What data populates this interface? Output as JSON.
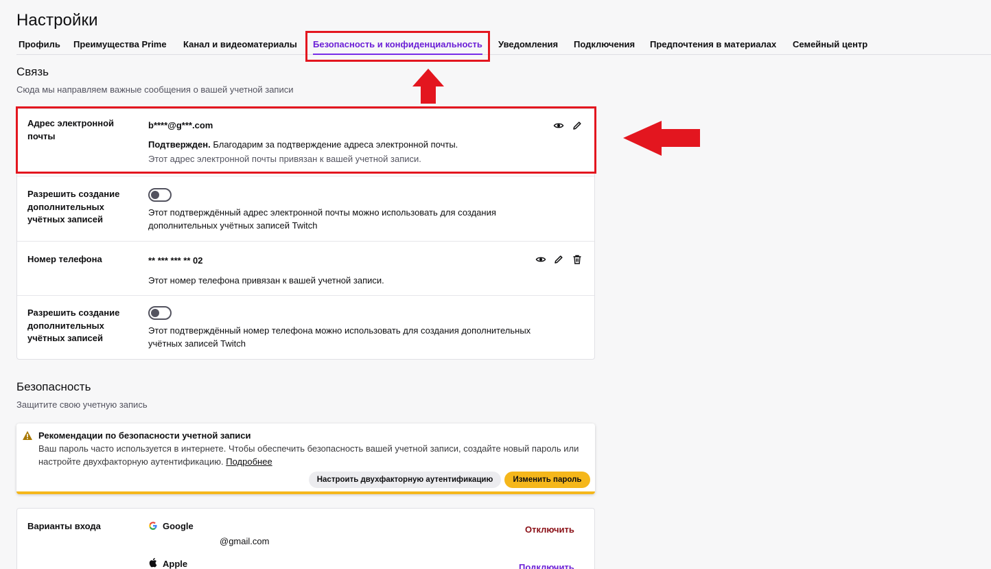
{
  "page": {
    "title": "Настройки"
  },
  "tabs": [
    {
      "label": "Профиль"
    },
    {
      "label": "Преимущества Prime"
    },
    {
      "label": "Канал и видеоматериалы"
    },
    {
      "label": "Безопасность и конфиденциальность",
      "active": true
    },
    {
      "label": "Уведомления"
    },
    {
      "label": "Подключения"
    },
    {
      "label": "Предпочтения в материалах"
    },
    {
      "label": "Семейный центр"
    }
  ],
  "contact": {
    "title": "Связь",
    "subtitle": "Сюда мы направляем важные сообщения о вашей учетной записи",
    "email": {
      "label": "Адрес электронной почты",
      "value": "b****@g***.com",
      "verified_bold": "Подтвержден.",
      "verified_text": "Благодарим за подтверждение адреса электронной почты.",
      "linked_text": "Этот адрес электронной почты привязан к вашей учетной записи."
    },
    "email_accounts": {
      "label": "Разрешить создание дополнительных учётных записей",
      "enabled": false,
      "text": "Этот подтверждённый адрес электронной почты можно использовать для создания дополнительных учётных записей Twitch"
    },
    "phone": {
      "label": "Номер телефона",
      "value": "** *** *** ** 02",
      "linked_text": "Этот номер телефона привязан к вашей учетной записи."
    },
    "phone_accounts": {
      "label": "Разрешить создание дополнительных учётных записей",
      "enabled": false,
      "text": "Этот подтверждённый номер телефона можно использовать для создания дополнительных учётных записей Twitch"
    }
  },
  "security": {
    "title": "Безопасность",
    "subtitle": "Защитите свою учетную запись",
    "alert": {
      "title": "Рекомендации по безопасности учетной записи",
      "text": "Ваш пароль часто используется в интернете. Чтобы обеспечить безопасность вашей учетной записи, создайте новый пароль или настройте двухфакторную аутентификацию.",
      "link": "Подробнее",
      "btn_2fa": "Настроить двухфакторную аутентификацию",
      "btn_password": "Изменить пароль"
    },
    "login": {
      "label": "Варианты входа",
      "google": {
        "name": "Google",
        "email": "@gmail.com",
        "action": "Отключить"
      },
      "apple": {
        "name": "Apple",
        "action": "Подключить"
      }
    }
  },
  "colors": {
    "accent": "#772ce8",
    "highlight_red": "#e3161f",
    "warning": "#f5b71b",
    "disconnect": "#8a0f16"
  },
  "icons": [
    "eye-icon",
    "pencil-icon",
    "trash-icon",
    "warning-icon",
    "google-icon",
    "apple-icon",
    "red-arrow-up",
    "red-arrow-left"
  ]
}
